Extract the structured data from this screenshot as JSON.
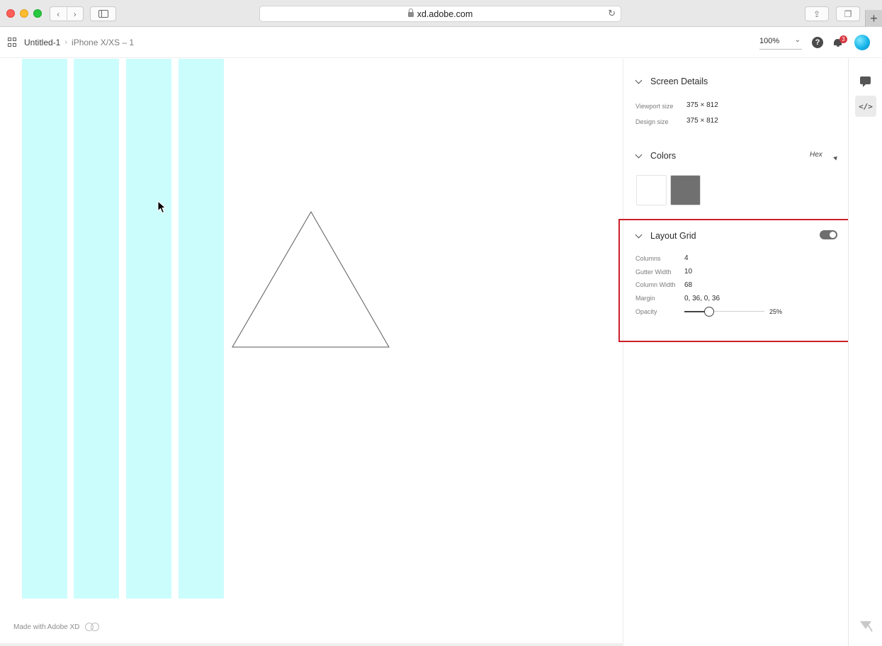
{
  "browser": {
    "url": "xd.adobe.com",
    "nav_back": "‹",
    "nav_forward": "›",
    "reload_glyph": "↻",
    "share_glyph": "⇪",
    "tabs_glyph": "❐",
    "new_tab_glyph": "+"
  },
  "header": {
    "document_name": "Untitled-1",
    "crumb_separator": "›",
    "artboard_name": "iPhone X/XS – 1",
    "zoom": "100%",
    "zoom_chevron": "⌄",
    "help_glyph": "?",
    "notification_count": "3"
  },
  "canvas": {
    "grid_color": "#ccfdfd",
    "triangle_stroke": "#5a5a5a",
    "footer_text": "Made with Adobe XD"
  },
  "panel": {
    "screen_details": {
      "title": "Screen Details",
      "rows": [
        {
          "label": "Viewport size",
          "value": "375 × 812"
        },
        {
          "label": "Design size",
          "value": "375 × 812"
        }
      ]
    },
    "colors": {
      "title": "Colors",
      "format": "Hex",
      "swatches": [
        "#ffffff",
        "#707070"
      ]
    },
    "layout_grid": {
      "title": "Layout Grid",
      "enabled": true,
      "rows": [
        {
          "label": "Columns",
          "value": "4"
        },
        {
          "label": "Gutter Width",
          "value": "10"
        },
        {
          "label": "Column Width",
          "value": "68"
        },
        {
          "label": "Margin",
          "value": "0, 36, 0, 36"
        }
      ],
      "opacity_label": "Opacity",
      "opacity_value": "25%",
      "opacity_fraction": 0.25
    }
  },
  "rail": {
    "code_glyph": "</>"
  },
  "accent": {
    "highlight": "#cc1f2a",
    "badge": "#d7373f",
    "avatar": "#17b5e8"
  }
}
